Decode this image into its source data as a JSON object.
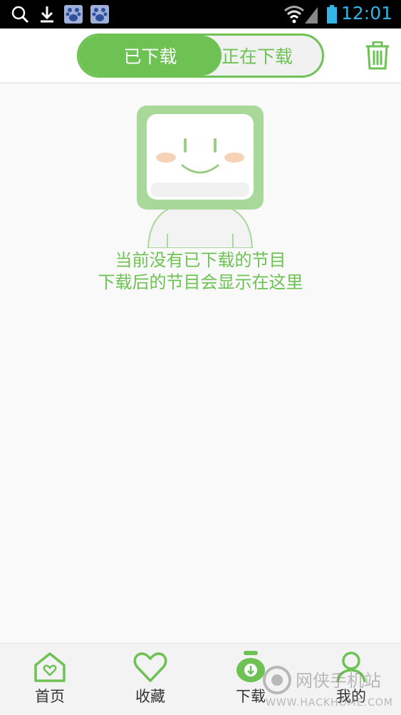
{
  "status_bar": {
    "time": "12:01"
  },
  "header": {
    "tabs": [
      {
        "label": "已下载",
        "active": true
      },
      {
        "label": "正在下载",
        "active": false
      }
    ],
    "accent_color": "#6ec253"
  },
  "empty_state": {
    "line1": "当前没有已下载的节目",
    "line2": "下载后的节目会显示在这里"
  },
  "bottom_nav": {
    "items": [
      {
        "label": "首页",
        "icon": "home-icon"
      },
      {
        "label": "收藏",
        "icon": "heart-icon"
      },
      {
        "label": "下载",
        "icon": "download-icon",
        "active": true
      },
      {
        "label": "我的",
        "icon": "user-icon"
      }
    ]
  },
  "watermark": {
    "text": "网侠手机站",
    "url": "WWW.HACKHOME.COM"
  }
}
